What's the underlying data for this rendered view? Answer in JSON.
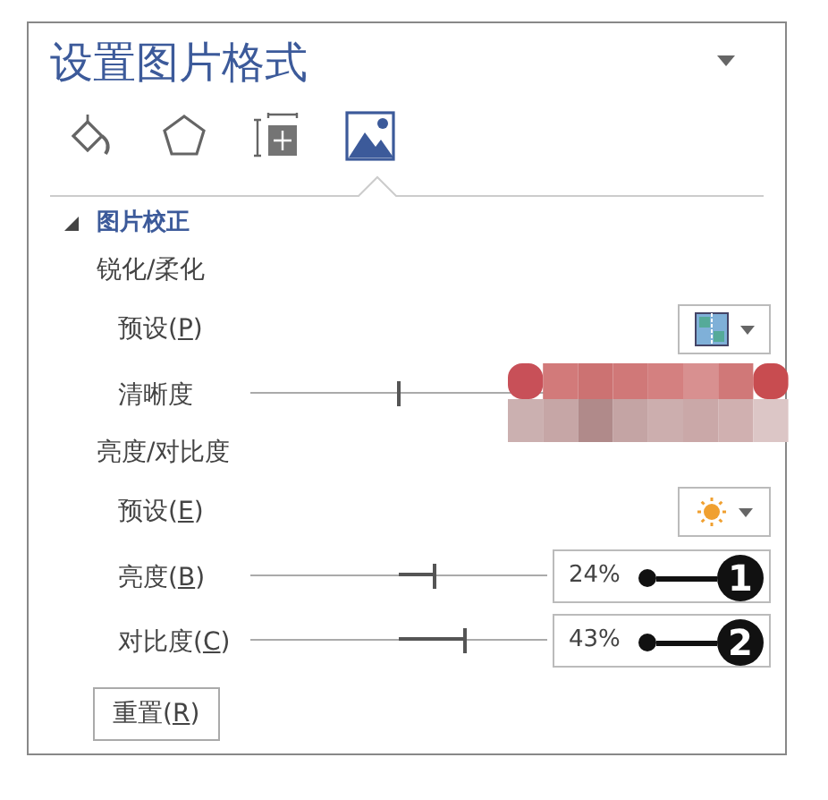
{
  "panel": {
    "title": "设置图片格式"
  },
  "tabs": [
    {
      "kind": "fill",
      "selected": false
    },
    {
      "kind": "effects",
      "selected": false
    },
    {
      "kind": "size",
      "selected": false
    },
    {
      "kind": "picture",
      "selected": true
    }
  ],
  "section": {
    "title": "图片校正",
    "expanded": true
  },
  "rows": [
    {
      "kind": "heading",
      "text": "锐化/柔化"
    },
    {
      "kind": "preset",
      "before": "预设(",
      "key": "P",
      "after": ")"
    },
    {
      "kind": "slider",
      "text": "清晰度",
      "level": 0.5
    },
    {
      "kind": "heading",
      "text": "亮度/对比度"
    },
    {
      "kind": "preset",
      "before": "预设(",
      "key": "E",
      "after": ")"
    },
    {
      "kind": "slider",
      "before": "亮度(",
      "key": "B",
      "after": ")",
      "level": 0.62,
      "value": "24%",
      "callout": "1"
    },
    {
      "kind": "slider",
      "before": "对比度(",
      "key": "C",
      "after": ")",
      "level": 0.72,
      "value": "43%",
      "callout": "2"
    }
  ],
  "reset": {
    "before": "重置(",
    "key": "R",
    "after": ")"
  }
}
